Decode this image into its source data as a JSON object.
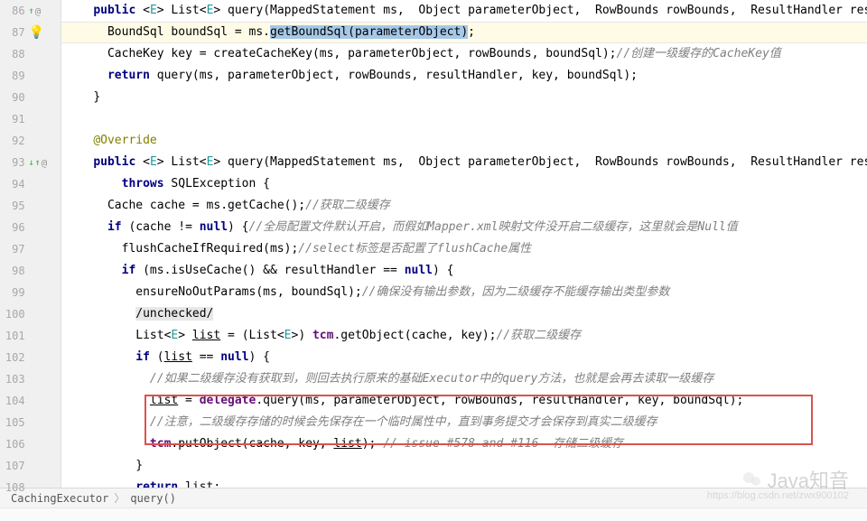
{
  "gutter": {
    "lines": [
      {
        "n": 86,
        "marks": "↑@"
      },
      {
        "n": 87,
        "bulb": true
      },
      {
        "n": 88
      },
      {
        "n": 89
      },
      {
        "n": 90
      },
      {
        "n": 91
      },
      {
        "n": 92
      },
      {
        "n": 93,
        "marks": "↓↑@"
      },
      {
        "n": 94
      },
      {
        "n": 95
      },
      {
        "n": 96
      },
      {
        "n": 97
      },
      {
        "n": 98
      },
      {
        "n": 99
      },
      {
        "n": 100
      },
      {
        "n": 101
      },
      {
        "n": 102
      },
      {
        "n": 103
      },
      {
        "n": 104
      },
      {
        "n": 105
      },
      {
        "n": 106
      },
      {
        "n": 107
      },
      {
        "n": 108
      }
    ]
  },
  "code": {
    "l86_kw1": "public",
    "l86_gen1": "E",
    "l86_type1": "List",
    "l86_gen2": "E",
    "l86_method": "query",
    "l86_p1": "MappedStatement ms,  Object parameterObject,  RowBounds rowBounds,  ResultHandler res",
    "l87_type": "BoundSql",
    "l87_var": "boundSql",
    "l87_eq": " = ms.",
    "l87_call": "getBoundSql(",
    "l87_arg": "parameterObject",
    "l87_close": ")",
    "l87_semi": ";",
    "l88_type": "CacheKey",
    "l88_rest": " key = createCacheKey(ms, parameterObject, rowBounds, boundSql);",
    "l88_cmt": "//创建一级缓存的CacheKey值",
    "l89_kw": "return",
    "l89_rest": " query(ms, parameterObject, rowBounds, resultHandler, key, boundSql);",
    "l90": "}",
    "l92_annot": "@Override",
    "l93_kw1": "public",
    "l93_gen1": "E",
    "l93_type1": "List",
    "l93_gen2": "E",
    "l93_method": "query",
    "l93_p1": "MappedStatement ms,  Object parameterObject,  RowBounds rowBounds,  ResultHandler res",
    "l94_kw": "throws",
    "l94_exc": " SQLException {",
    "l95_type": "Cache",
    "l95_rest": " cache = ms.getCache();",
    "l95_cmt": "//获取二级缓存",
    "l96_kw": "if",
    "l96_cond": " (cache != ",
    "l96_null": "null",
    "l96_brace": ") {",
    "l96_cmt": "//全局配置文件默认开启，而假如Mapper.xml映射文件没开启二级缓存，这里就会是Null值",
    "l97_call": "flushCacheIfRequired(ms);",
    "l97_cmt": "//select标签是否配置了flushCache属性",
    "l98_kw": "if",
    "l98_cond": " (ms.isUseCache() && resultHandler == ",
    "l98_null": "null",
    "l98_brace": ") {",
    "l99_call": "ensureNoOutParams(ms, boundSql);",
    "l99_cmt": "//确保没有输出参数，因为二级缓存不能缓存输出类型参数",
    "l100_box": "/unchecked/",
    "l101_type": "List",
    "l101_gen": "E",
    "l101_var": "list",
    "l101_rest": " = (List",
    "l101_gen2": "E",
    "l101_rest2": ") ",
    "l101_tcm": "tcm",
    "l101_call": ".getObject(cache, key);",
    "l101_cmt": "//获取二级缓存",
    "l102_kw": "if",
    "l102_cond": " (",
    "l102_var": "list",
    "l102_eq": " == ",
    "l102_null": "null",
    "l102_brace": ") {",
    "l103_cmt": "//如果二级缓存没有获取到，则回去执行原来的基础Executor中的query方法，也就是会再去读取一级缓存",
    "l104_var": "list",
    "l104_eq": " = ",
    "l104_del": "delegate",
    "l104_rest": ".query(ms, parameterObject, rowBounds, resultHandler, key, boundSql);",
    "l105_cmt": "//注意，二级缓存存储的时候会先保存在一个临时属性中，直到事务提交才会保存到真实二级缓存",
    "l106_tcm": "tcm",
    "l106_call": ".putObject(cache, key, ",
    "l106_var": "list",
    "l106_close": "); ",
    "l106_cmt": "// issue #578 and #116  存储二级缓存",
    "l107": "}",
    "l108_kw": "return",
    "l108_var": "list",
    "l108_semi": ";"
  },
  "breadcrumb": {
    "item1": "CachingExecutor",
    "item2": "query()"
  },
  "watermark": {
    "text": "Java知音",
    "sub": "https://blog.csdn.net/zwx900102"
  }
}
